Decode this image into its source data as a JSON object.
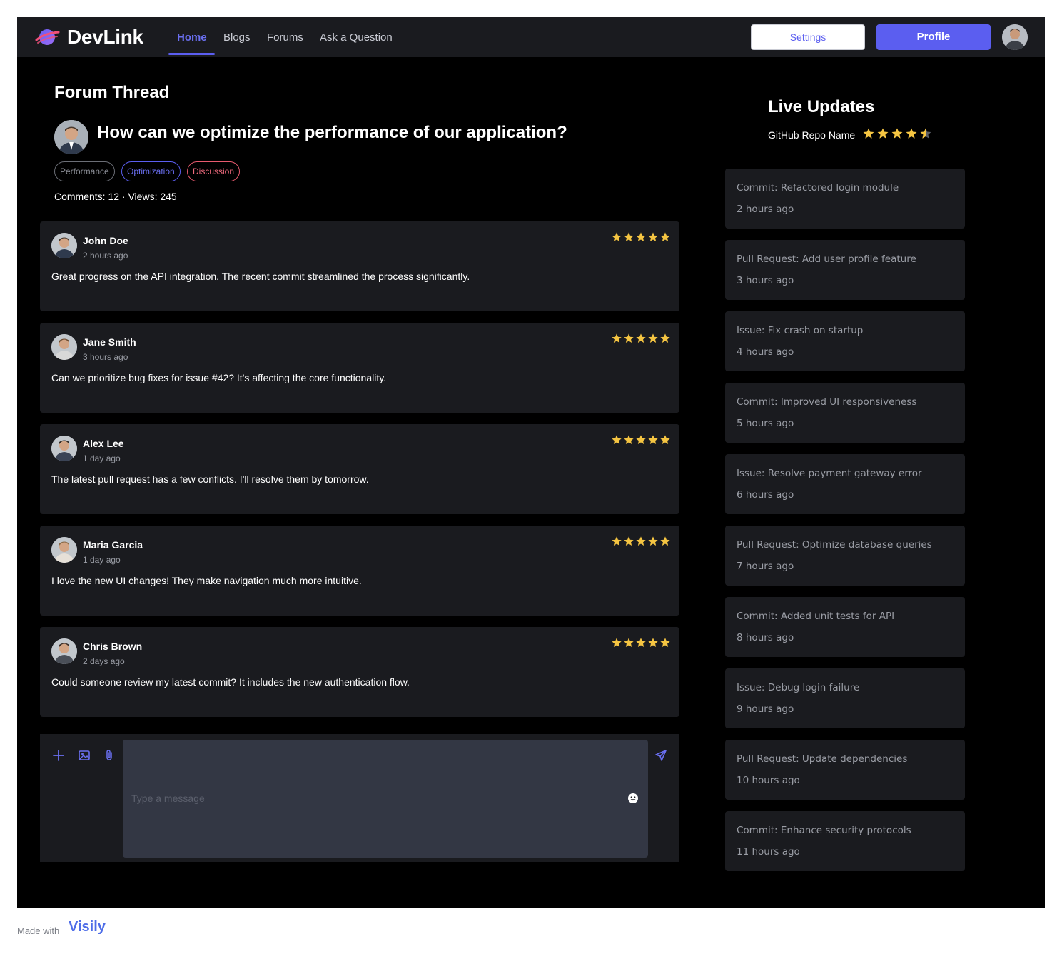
{
  "app": {
    "brand": "DevLink",
    "nav": [
      {
        "label": "Home",
        "active": true
      },
      {
        "label": "Blogs"
      },
      {
        "label": "Forums"
      },
      {
        "label": "Ask a Question"
      }
    ],
    "settings_label": "Settings",
    "profile_label": "Profile",
    "accent": "#5b5ef0"
  },
  "thread": {
    "section_title": "Forum Thread",
    "question": "How can we optimize the performance of our application?",
    "tags": [
      "Performance",
      "Optimization",
      "Discussion"
    ],
    "stats": "Comments: 12 · Views: 245"
  },
  "comments": [
    {
      "name": "John Doe",
      "time": "2 hours ago",
      "text": "Great progress on the API integration. The recent commit streamlined the process significantly.",
      "rating": 5
    },
    {
      "name": "Jane Smith",
      "time": "3 hours ago",
      "text": "Can we prioritize bug fixes for issue #42? It's affecting the core functionality.",
      "rating": 5
    },
    {
      "name": "Alex Lee",
      "time": "1 day ago",
      "text": "The latest pull request has a few conflicts. I'll resolve them by tomorrow.",
      "rating": 5
    },
    {
      "name": "Maria Garcia",
      "time": "1 day ago",
      "text": "I love the new UI changes! They make navigation much more intuitive.",
      "rating": 5
    },
    {
      "name": "Chris Brown",
      "time": "2 days ago",
      "text": "Could someone review my latest commit? It includes the new authentication flow.",
      "rating": 5
    }
  ],
  "composer": {
    "placeholder": "Type a message",
    "icons": [
      "plus-icon",
      "image-icon",
      "paperclip-icon",
      "smile-icon",
      "send-icon"
    ]
  },
  "live": {
    "title": "Live Updates",
    "repo_name": "GitHub Repo Name",
    "repo_rating": 4.5,
    "updates": [
      {
        "title": "Commit: Refactored login module",
        "time": "2 hours ago"
      },
      {
        "title": "Pull Request: Add user profile feature",
        "time": "3 hours ago"
      },
      {
        "title": "Issue: Fix crash on startup",
        "time": "4 hours ago"
      },
      {
        "title": "Commit: Improved UI responsiveness",
        "time": "5 hours ago"
      },
      {
        "title": "Issue: Resolve payment gateway error",
        "time": "6 hours ago"
      },
      {
        "title": "Pull Request: Optimize database queries",
        "time": "7 hours ago"
      },
      {
        "title": "Commit: Added unit tests for API",
        "time": "8 hours ago"
      },
      {
        "title": "Issue: Debug login failure",
        "time": "9 hours ago"
      },
      {
        "title": "Pull Request: Update dependencies",
        "time": "10 hours ago"
      },
      {
        "title": "Commit: Enhance security protocols",
        "time": "11 hours ago"
      }
    ]
  },
  "footer": {
    "made_with": "Made with",
    "brand": "Visily"
  }
}
